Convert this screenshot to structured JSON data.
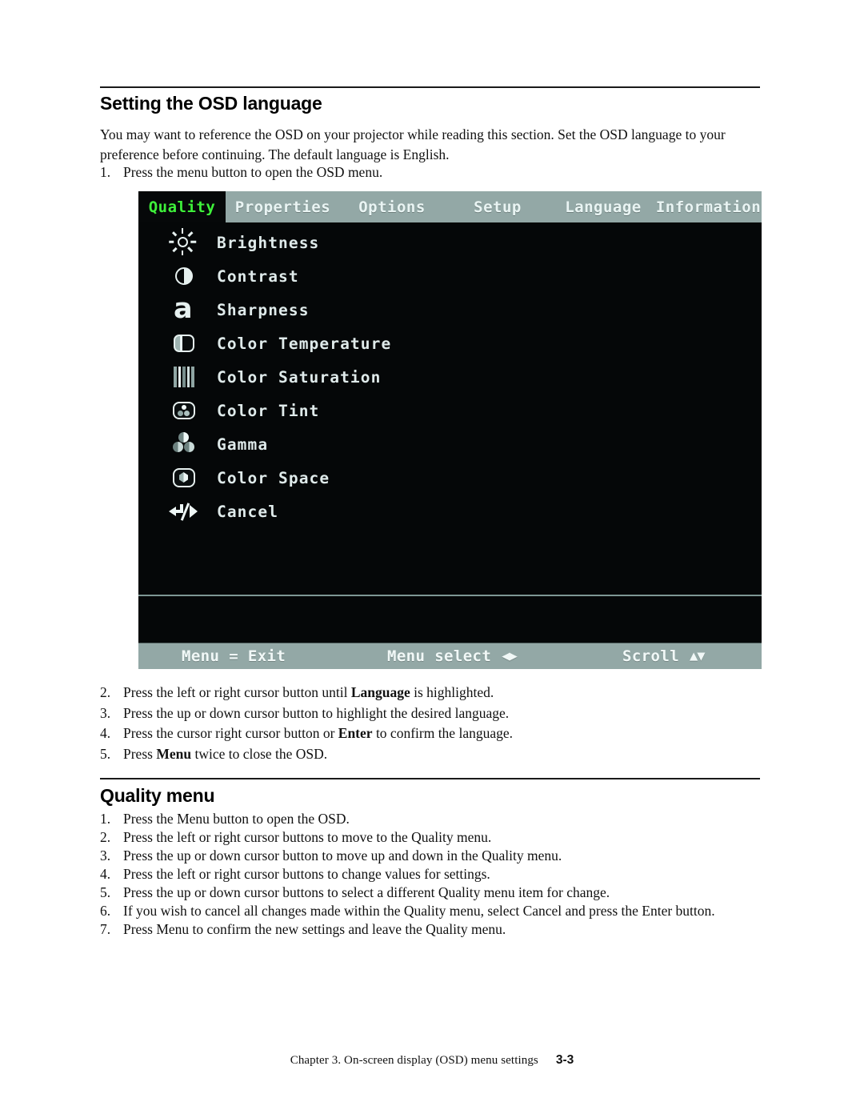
{
  "document": {
    "section1": {
      "heading": "Setting the OSD language",
      "intro": "You may want to reference the OSD on your projector while reading this section. Set the OSD language to your preference before continuing. The default language is English.",
      "steps_before": [
        {
          "num": "1.",
          "text": "Press the menu button to open the OSD menu."
        }
      ],
      "steps_after": [
        {
          "num": "2.",
          "pre": "Press the left or right cursor button until ",
          "bold": "Language",
          "post": " is highlighted."
        },
        {
          "num": "3.",
          "pre": "Press the up or down cursor button to highlight the desired language.",
          "bold": "",
          "post": ""
        },
        {
          "num": "4.",
          "pre": " Press the cursor right cursor button or ",
          "bold": "Enter",
          "post": " to confirm the language."
        },
        {
          "num": "5.",
          "pre": "Press ",
          "bold": "Menu",
          "post": " twice to close the OSD."
        }
      ]
    },
    "section2": {
      "heading": "Quality menu",
      "steps": [
        {
          "num": "1.",
          "text": "Press the Menu button to open the OSD."
        },
        {
          "num": "2.",
          "text": "Press the left or right cursor buttons to move to the Quality menu."
        },
        {
          "num": "3.",
          "text": "Press the up or down cursor button to move up and down in the Quality menu."
        },
        {
          "num": "4.",
          "text": "Press the left or right cursor buttons to change values for settings."
        },
        {
          "num": "5.",
          "text": "Press the up or down cursor buttons to select a different Quality menu item for change."
        },
        {
          "num": "6.",
          "text": "If you wish to cancel all changes made within the Quality menu, select Cancel and press the Enter button."
        },
        {
          "num": "7.",
          "text": "Press Menu to confirm the new settings and leave the Quality menu."
        }
      ]
    },
    "footer": {
      "text": "Chapter 3. On-screen display (OSD) menu settings",
      "page": "3-3"
    }
  },
  "osd": {
    "colors": {
      "background": "#050708",
      "bar": "#93a8a6",
      "active_tab_text": "#3ef03a",
      "active_tab_bg": "#060809",
      "item_text": "#dfeaea",
      "bar_text": "#f1f8f7"
    },
    "tabs": [
      {
        "label": "Quality",
        "active": true
      },
      {
        "label": "Properties",
        "active": false
      },
      {
        "label": "Options",
        "active": false
      },
      {
        "label": "Setup",
        "active": false
      },
      {
        "label": "Language",
        "active": false
      },
      {
        "label": "Information",
        "active": false
      }
    ],
    "items": [
      {
        "label": "Brightness",
        "icon": "sun-icon"
      },
      {
        "label": "Contrast",
        "icon": "half-circle-icon"
      },
      {
        "label": "Sharpness",
        "icon": "letter-a-icon"
      },
      {
        "label": "Color Temperature",
        "icon": "gradient-panel-icon"
      },
      {
        "label": "Color Saturation",
        "icon": "bars-icon"
      },
      {
        "label": "Color Tint",
        "icon": "dots-panel-icon"
      },
      {
        "label": "Gamma",
        "icon": "three-circles-icon"
      },
      {
        "label": "Color Space",
        "icon": "cube-panel-icon"
      },
      {
        "label": "Cancel",
        "icon": "return-arrow-icon"
      }
    ],
    "hints": {
      "exit": "Menu = Exit",
      "select": "Menu select",
      "select_arrows": "◀▶",
      "scroll": "Scroll",
      "scroll_arrows": "▲▼"
    }
  }
}
